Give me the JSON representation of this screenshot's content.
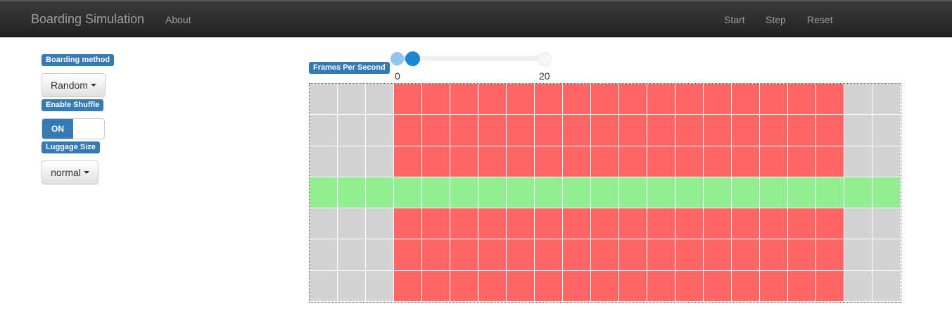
{
  "navbar": {
    "brand": "Boarding Simulation",
    "links": [
      "About",
      "Start",
      "Step",
      "Reset"
    ]
  },
  "controls": {
    "boarding_method": {
      "label": "Boarding method",
      "value": "Random"
    },
    "shuffle": {
      "label": "Enable Shuffle",
      "state": "ON"
    },
    "luggage": {
      "label": "Luggage Size",
      "value": "normal"
    }
  },
  "fps": {
    "label": "Frames Per Second",
    "min": 0,
    "max": 20,
    "min_label": "0",
    "max_label": "20",
    "value": 2
  },
  "seat_grid": {
    "columns": 21,
    "rows": [
      "seat",
      "seat",
      "seat",
      "aisle",
      "seat",
      "seat",
      "seat"
    ],
    "seat_columns_start": 3,
    "seat_columns_end": 18,
    "colors": {
      "seat": "#ff6666",
      "empty": "#d3d3d3",
      "aisle": "#90ee90",
      "divider": "#ffffff"
    }
  }
}
